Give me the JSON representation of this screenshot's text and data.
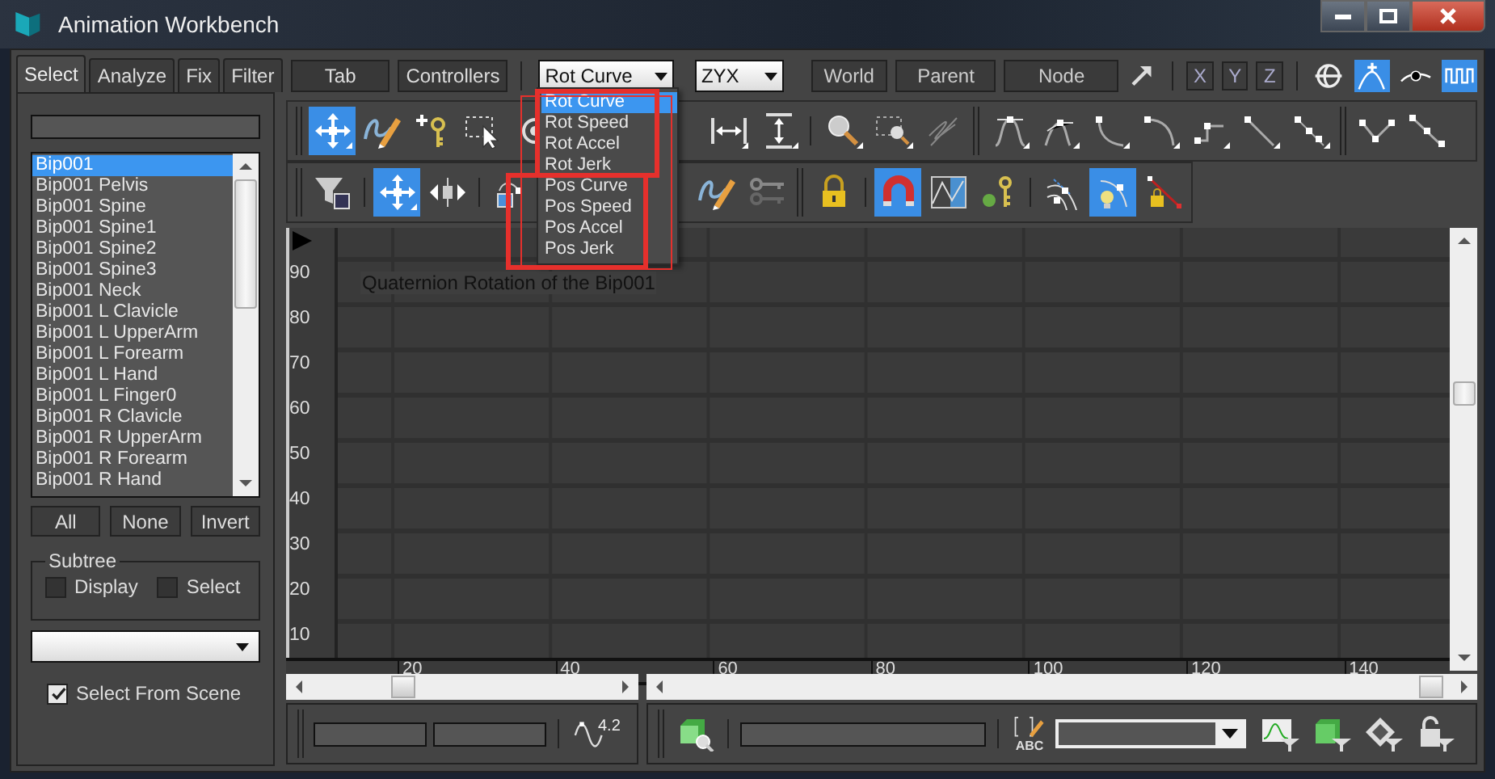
{
  "window": {
    "title": "Animation Workbench"
  },
  "left_tabs": [
    {
      "label": "Select",
      "selected": true
    },
    {
      "label": "Analyze",
      "selected": false
    },
    {
      "label": "Fix",
      "selected": false
    },
    {
      "label": "Filter",
      "selected": false
    }
  ],
  "bone_list": [
    {
      "label": "Bip001",
      "selected": true
    },
    {
      "label": "Bip001 Pelvis",
      "selected": false
    },
    {
      "label": "Bip001 Spine",
      "selected": false
    },
    {
      "label": "Bip001 Spine1",
      "selected": false
    },
    {
      "label": "Bip001 Spine2",
      "selected": false
    },
    {
      "label": "Bip001 Spine3",
      "selected": false
    },
    {
      "label": "Bip001 Neck",
      "selected": false
    },
    {
      "label": "Bip001 L Clavicle",
      "selected": false
    },
    {
      "label": "Bip001 L UpperArm",
      "selected": false
    },
    {
      "label": "Bip001 L Forearm",
      "selected": false
    },
    {
      "label": "Bip001 L Hand",
      "selected": false
    },
    {
      "label": "Bip001 L Finger0",
      "selected": false
    },
    {
      "label": "Bip001 R Clavicle",
      "selected": false
    },
    {
      "label": "Bip001 R UpperArm",
      "selected": false
    },
    {
      "label": "Bip001 R Forearm",
      "selected": false
    },
    {
      "label": "Bip001 R Hand",
      "selected": false
    }
  ],
  "list_buttons": [
    "All",
    "None",
    "Invert"
  ],
  "subtree": {
    "title": "Subtree",
    "options": [
      {
        "label": "Display",
        "checked": false
      },
      {
        "label": "Select",
        "checked": false
      }
    ]
  },
  "select_from_scene": {
    "label": "Select From Scene",
    "checked": true
  },
  "top_bar": {
    "buttons": [
      "Tab",
      "Controllers"
    ],
    "curve_dropdown": {
      "value": "Rot Curve",
      "expanded": true,
      "items": [
        {
          "label": "Rot Curve",
          "selected": true
        },
        {
          "label": "Rot Speed",
          "selected": false
        },
        {
          "label": "Rot Accel",
          "selected": false
        },
        {
          "label": "Rot Jerk",
          "selected": false
        },
        {
          "label": "Pos Curve",
          "selected": false
        },
        {
          "label": "Pos Speed",
          "selected": false
        },
        {
          "label": "Pos Accel",
          "selected": false
        },
        {
          "label": "Pos Jerk",
          "selected": false
        }
      ]
    },
    "order_dropdown": {
      "value": "ZYX"
    },
    "space_buttons": [
      "World",
      "Parent",
      "Node"
    ],
    "axis_buttons": [
      "X",
      "Y",
      "Z"
    ],
    "toggles": [
      {
        "selected": false
      },
      {
        "selected": true
      },
      {
        "selected": false
      },
      {
        "selected": true
      }
    ]
  },
  "toolbar_1": [
    {
      "selected": true
    },
    {
      "selected": false
    },
    {
      "selected": false
    },
    {
      "selected": false
    },
    {
      "selected": false
    },
    {
      "selected": false
    },
    {
      "selected": false
    },
    {
      "selected": false
    },
    {
      "selected": false
    },
    {
      "selected": false
    },
    {
      "selected": false
    },
    {
      "selected": false
    },
    {
      "selected": false
    },
    {
      "selected": false
    },
    {
      "selected": false
    },
    {
      "selected": false
    },
    {
      "selected": false
    },
    {
      "selected": false
    },
    {
      "selected": false
    }
  ],
  "toolbar_2": [
    {
      "selected": false
    },
    {
      "selected": true
    },
    {
      "selected": false
    },
    {
      "selected": false
    },
    {
      "selected": false
    },
    {
      "selected": false
    },
    {
      "selected": false
    },
    {
      "selected": true
    },
    {
      "selected": false
    },
    {
      "selected": false
    },
    {
      "selected": false
    },
    {
      "selected": true
    },
    {
      "selected": false
    }
  ],
  "graph": {
    "title": "Quaternion Rotation of the Bip001",
    "y_axis_labels": [
      "90",
      "80",
      "70",
      "60",
      "50",
      "40",
      "30",
      "20",
      "10"
    ],
    "x_axis_labels": [
      "20",
      "40",
      "60",
      "80",
      "100",
      "120",
      "140"
    ]
  },
  "bottom_bar": {
    "curve_value": "4.2",
    "rename_label": "ABC"
  }
}
